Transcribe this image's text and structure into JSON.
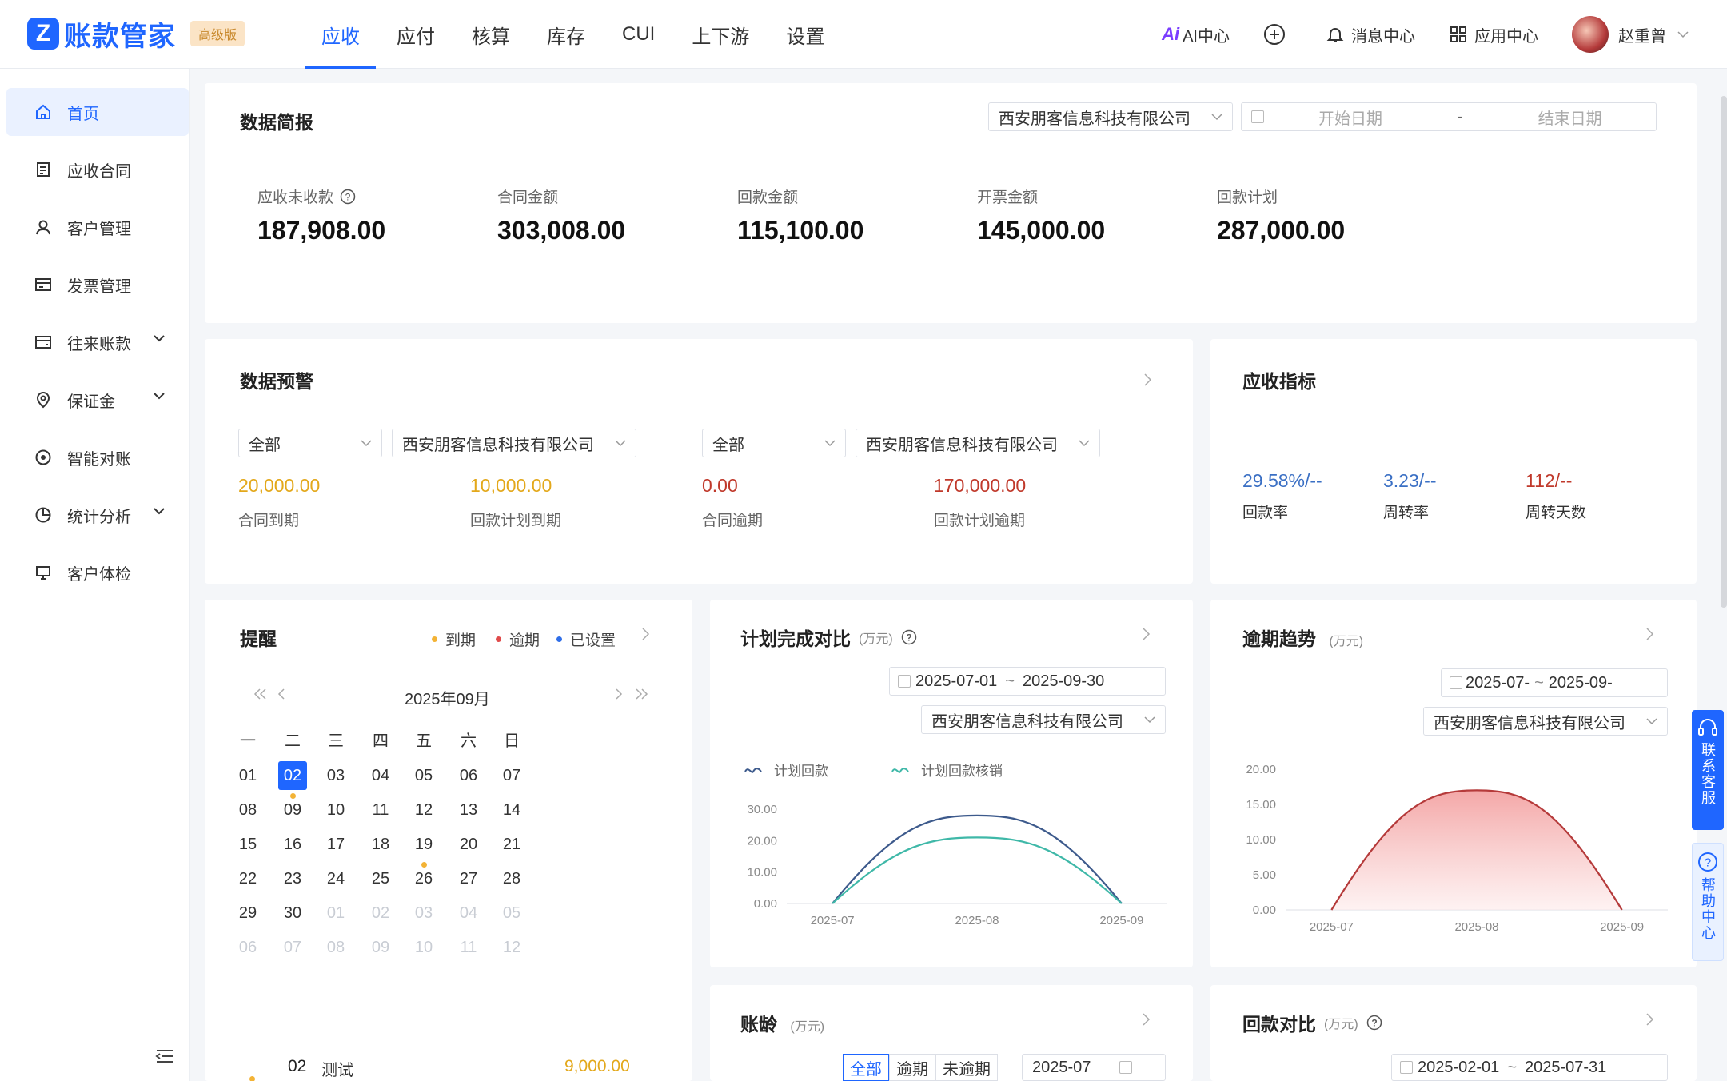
{
  "app": {
    "name": "账款管家",
    "edition": "高级版"
  },
  "nav": [
    {
      "label": "应收",
      "active": true
    },
    {
      "label": "应付"
    },
    {
      "label": "核算"
    },
    {
      "label": "库存"
    },
    {
      "label": "CUI"
    },
    {
      "label": "上下游"
    },
    {
      "label": "设置"
    }
  ],
  "topright": {
    "ai": "AI中心",
    "messages": "消息中心",
    "apps": "应用中心",
    "user": "赵重曾"
  },
  "sidebar": [
    {
      "label": "首页",
      "icon": "home-icon",
      "active": true
    },
    {
      "label": "应收合同",
      "icon": "contract-icon"
    },
    {
      "label": "客户管理",
      "icon": "user-icon"
    },
    {
      "label": "发票管理",
      "icon": "invoice-icon"
    },
    {
      "label": "往来账款",
      "icon": "ledger-icon",
      "expand": true
    },
    {
      "label": "保证金",
      "icon": "location-icon",
      "expand": true
    },
    {
      "label": "智能对账",
      "icon": "target-icon"
    },
    {
      "label": "统计分析",
      "icon": "pie-icon",
      "expand": true
    },
    {
      "label": "客户体检",
      "icon": "monitor-icon"
    }
  ],
  "summary": {
    "title": "数据简报",
    "company": "西安朋客信息科技有限公司",
    "start_placeholder": "开始日期",
    "end_placeholder": "结束日期",
    "date_sep": "-",
    "stats": [
      {
        "label": "应收未收款",
        "value": "187,908.00",
        "help": true
      },
      {
        "label": "合同金额",
        "value": "303,008.00"
      },
      {
        "label": "回款金额",
        "value": "115,100.00"
      },
      {
        "label": "开票金额",
        "value": "145,000.00"
      },
      {
        "label": "回款计划",
        "value": "287,000.00"
      }
    ]
  },
  "warning": {
    "title": "数据预警",
    "left": {
      "filter": "全部",
      "company": "西安朋客信息科技有限公司",
      "items": [
        {
          "value": "20,000.00",
          "label": "合同到期",
          "color": "#e3a81b"
        },
        {
          "value": "10,000.00",
          "label": "回款计划到期",
          "color": "#e3a81b"
        }
      ]
    },
    "right": {
      "filter": "全部",
      "company": "西安朋客信息科技有限公司",
      "items": [
        {
          "value": "0.00",
          "label": "合同逾期",
          "color": "#c0392b"
        },
        {
          "value": "170,000.00",
          "label": "回款计划逾期",
          "color": "#c0392b"
        }
      ]
    }
  },
  "kpi": {
    "title": "应收指标",
    "items": [
      {
        "value": "29.58%/--",
        "label": "回款率",
        "color": "#3a6fc4"
      },
      {
        "value": "3.23/--",
        "label": "周转率",
        "color": "#3a6fc4"
      },
      {
        "value": "112/--",
        "label": "周转天数",
        "color": "#c0392b"
      }
    ]
  },
  "reminder": {
    "title": "提醒",
    "legend": [
      {
        "label": "到期",
        "color": "#f3b336"
      },
      {
        "label": "逾期",
        "color": "#e04b4b"
      },
      {
        "label": "已设置",
        "color": "#2f6ee8"
      }
    ],
    "month": "2025年09月",
    "weekdays": [
      "一",
      "二",
      "三",
      "四",
      "五",
      "六",
      "日"
    ],
    "weeks": [
      [
        "01",
        "02",
        "03",
        "04",
        "05",
        "06",
        "07"
      ],
      [
        "08",
        "09",
        "10",
        "11",
        "12",
        "13",
        "14"
      ],
      [
        "15",
        "16",
        "17",
        "18",
        "19",
        "20",
        "21"
      ],
      [
        "22",
        "23",
        "24",
        "25",
        "26",
        "27",
        "28"
      ],
      [
        "29",
        "30",
        "01",
        "02",
        "03",
        "04",
        "05"
      ],
      [
        "06",
        "07",
        "08",
        "09",
        "10",
        "11",
        "12"
      ]
    ],
    "entry": {
      "day": "02",
      "text": "测试",
      "amount": "9,000.00"
    }
  },
  "plan": {
    "title": "计划完成对比",
    "unit": "(万元)",
    "range_start": "2025-07-01",
    "range_end": "2025-09-30",
    "range_sep": "~",
    "company": "西安朋客信息科技有限公司",
    "legend": [
      "计划回款",
      "计划回款核销"
    ]
  },
  "overdue": {
    "title": "逾期趋势",
    "unit": "(万元)",
    "range_start": "2025-07-",
    "range_end": "2025-09-",
    "range_sep": "~",
    "company": "西安朋客信息科技有限公司"
  },
  "aging": {
    "title": "账龄",
    "unit": "(万元)",
    "tabs": [
      "全部",
      "逾期",
      "未逾期"
    ],
    "month": "2025-07"
  },
  "payback": {
    "title": "回款对比",
    "unit": "(万元)",
    "range_start": "2025-02-01",
    "range_end": "2025-07-31",
    "range_sep": "~"
  },
  "float": {
    "service": "联系客服",
    "help": "帮助中心"
  },
  "chart_data": [
    {
      "type": "line",
      "title": "计划完成对比",
      "x": [
        "2025-07",
        "2025-08",
        "2025-09"
      ],
      "y_ticks": [
        "0.00",
        "10.00",
        "20.00",
        "30.00"
      ],
      "ylim": [
        0,
        30
      ],
      "series": [
        {
          "name": "计划回款",
          "values": [
            0,
            28,
            0
          ],
          "color": "#3d5a8c"
        },
        {
          "name": "计划回款核销",
          "values": [
            0,
            21,
            0
          ],
          "color": "#3fb8a8"
        }
      ]
    },
    {
      "type": "area",
      "title": "逾期趋势",
      "x": [
        "2025-07",
        "2025-08",
        "2025-09"
      ],
      "y_ticks": [
        "0.00",
        "5.00",
        "10.00",
        "15.00",
        "20.00"
      ],
      "ylim": [
        0,
        20
      ],
      "series": [
        {
          "values": [
            0,
            17,
            0
          ],
          "color": "#b53a3a"
        }
      ]
    }
  ]
}
